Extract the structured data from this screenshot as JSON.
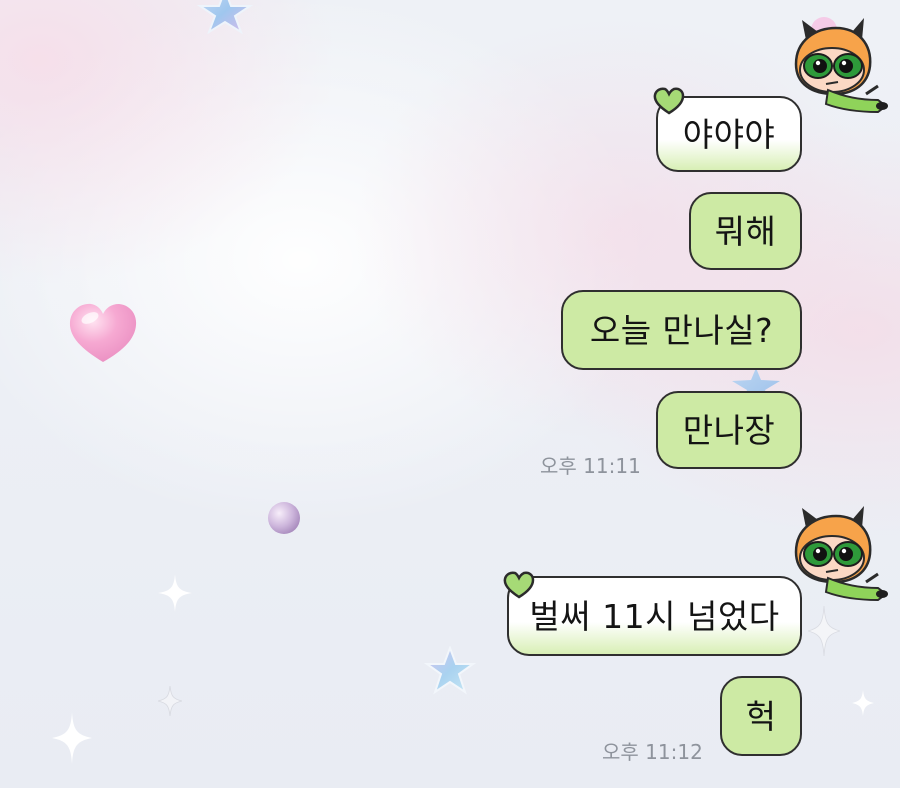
{
  "chat": {
    "groups": [
      {
        "messages": [
          "야야야",
          "뭐해",
          "오늘 만나실?",
          "만나장"
        ],
        "time": "오후 11:11"
      },
      {
        "messages": [
          "벌써 11시 넘었다",
          "헉"
        ],
        "time": "오후 11:12"
      }
    ]
  },
  "colors": {
    "bubble_green": "#cdeaa4",
    "bubble_border": "#2f2f2f",
    "time_text": "#8e939c",
    "heart_pink": "#f2a6cf"
  },
  "icons": [
    "buttercup-avatar-icon",
    "green-heart-tag-icon",
    "pink-heart-icon",
    "star-icon",
    "sparkle-icon",
    "pearl-icon"
  ]
}
